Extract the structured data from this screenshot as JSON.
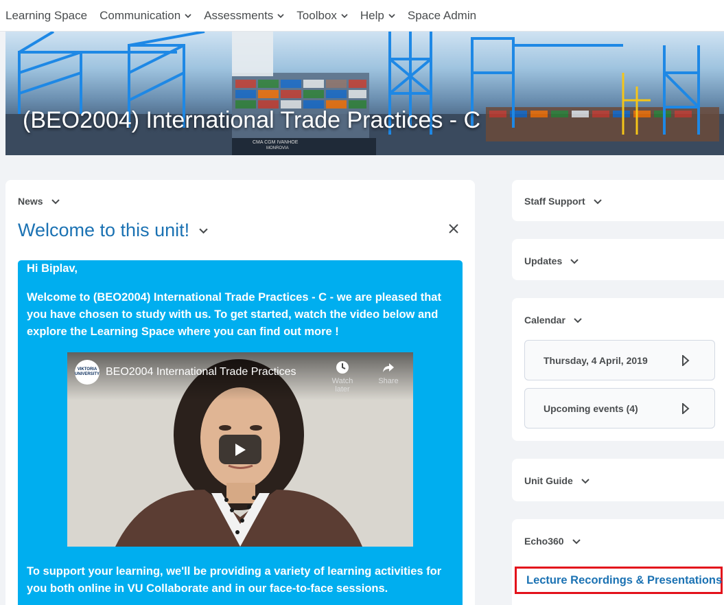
{
  "nav": {
    "items": [
      {
        "label": "Learning Space",
        "dropdown": false
      },
      {
        "label": "Communication",
        "dropdown": true
      },
      {
        "label": "Assessments",
        "dropdown": true
      },
      {
        "label": "Toolbox",
        "dropdown": true
      },
      {
        "label": "Help",
        "dropdown": true
      },
      {
        "label": "Space Admin",
        "dropdown": false
      }
    ]
  },
  "banner": {
    "title": "(BEO2004) International Trade Practices - C",
    "ship_text": "CMA CGM IVANHOE",
    "ship_subtext": "MONROVIA"
  },
  "news": {
    "widget_label": "News",
    "title": "Welcome to this unit!",
    "greeting": "Hi Biplav,",
    "intro": "Welcome to (BEO2004) International Trade Practices - C - we are pleased that you have chosen to study with us. To get started, watch the video below and explore the Learning Space where you can find out more !",
    "video": {
      "title": "BEO2004 International Trade Practices",
      "logo_text": "VIKTORIA UNIVERSITY",
      "watch_later": "Watch later",
      "share": "Share"
    },
    "closing": "To support your learning, we'll be providing a variety of learning activities for you both online in VU Collaborate and in our face-to-face sessions."
  },
  "sidebar": {
    "staff_support": "Staff Support",
    "updates": "Updates",
    "calendar": {
      "label": "Calendar",
      "date": "Thursday, 4 April, 2019",
      "upcoming": "Upcoming events (4)"
    },
    "unit_guide": "Unit Guide",
    "echo360": {
      "label": "Echo360",
      "link": "Lecture Recordings & Presentations"
    }
  },
  "colors": {
    "link_blue": "#1b72b3",
    "welcome_box": "#00aeef",
    "highlight_red": "#e3111b"
  }
}
